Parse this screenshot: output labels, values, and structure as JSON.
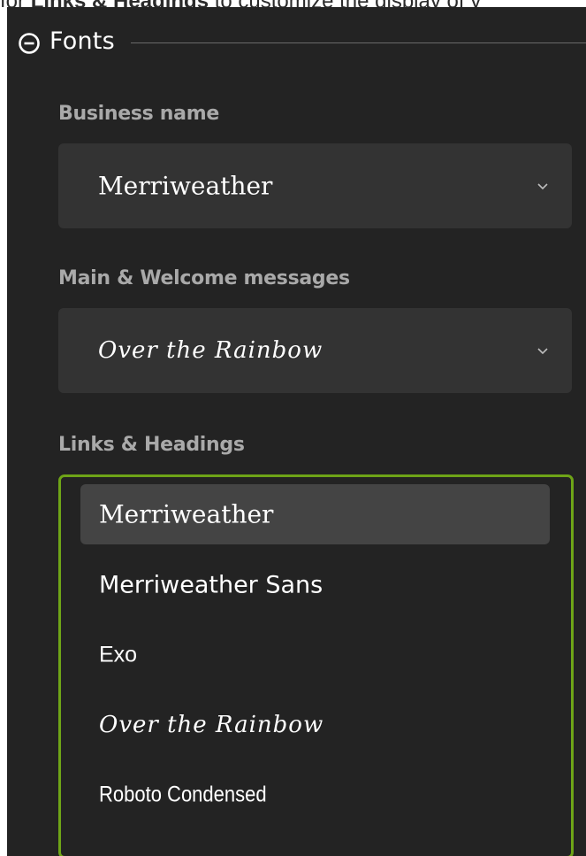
{
  "instruction": {
    "prefix": "for ",
    "emphasis": "Links & Headings",
    "suffix": " to customize the display of y"
  },
  "section": {
    "title": "Fonts",
    "collapse_icon": "minus-circle-icon"
  },
  "fields": {
    "business_name": {
      "label": "Business name",
      "value": "Merriweather"
    },
    "main_welcome": {
      "label": "Main & Welcome messages",
      "value": "Over the Rainbow"
    },
    "links_headings": {
      "label": "Links & Headings",
      "options": [
        "Merriweather",
        "Merriweather Sans",
        "Exo",
        "Over the Rainbow",
        "Roboto Condensed"
      ],
      "selected": "Merriweather"
    }
  },
  "colors": {
    "panel_background": "#232323",
    "select_background": "#333333",
    "selected_option": "#444444",
    "focus_border": "#6ea417",
    "label_gray": "#a9a9a9"
  }
}
